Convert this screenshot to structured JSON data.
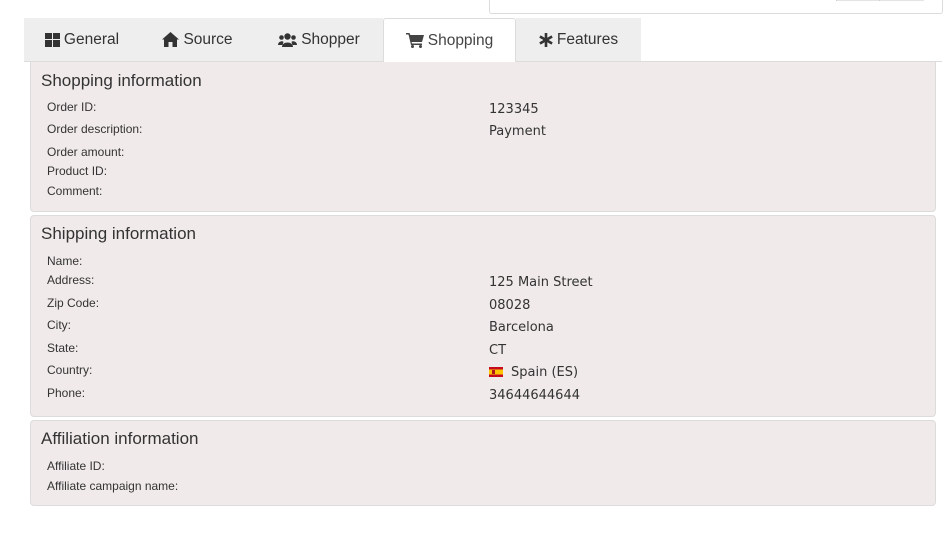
{
  "tabs": [
    {
      "label": "General",
      "icon": "grid-icon"
    },
    {
      "label": "Source",
      "icon": "home-icon"
    },
    {
      "label": "Shopper",
      "icon": "users-icon"
    },
    {
      "label": "Shopping",
      "icon": "shopping-cart-icon",
      "active": true
    },
    {
      "label": "Features",
      "icon": "asterisk-icon"
    }
  ],
  "shopping": {
    "title": "Shopping information",
    "order_id_label": "Order ID:",
    "order_id": "123345",
    "order_description_label": "Order description:",
    "order_description": "Payment",
    "order_amount_label": "Order amount:",
    "product_id_label": "Product ID:",
    "comment_label": "Comment:"
  },
  "shipping": {
    "title": "Shipping information",
    "name_label": "Name:",
    "address_label": "Address:",
    "address": "125 Main Street",
    "zip_label": "Zip Code:",
    "zip": "08028",
    "city_label": "City:",
    "city": "Barcelona",
    "state_label": "State:",
    "state": "CT",
    "country_label": "Country:",
    "country": "Spain (ES)",
    "country_flag": "spain-flag-icon",
    "phone_label": "Phone:",
    "phone": "34644644644"
  },
  "affiliation": {
    "title": "Affiliation information",
    "affiliate_id_label": "Affiliate ID:",
    "campaign_label": "Affiliate campaign name:"
  },
  "colors": {
    "panel_bg": "#f1eaea",
    "tab_bg": "#eeeeee",
    "border": "#dcdcdc"
  }
}
